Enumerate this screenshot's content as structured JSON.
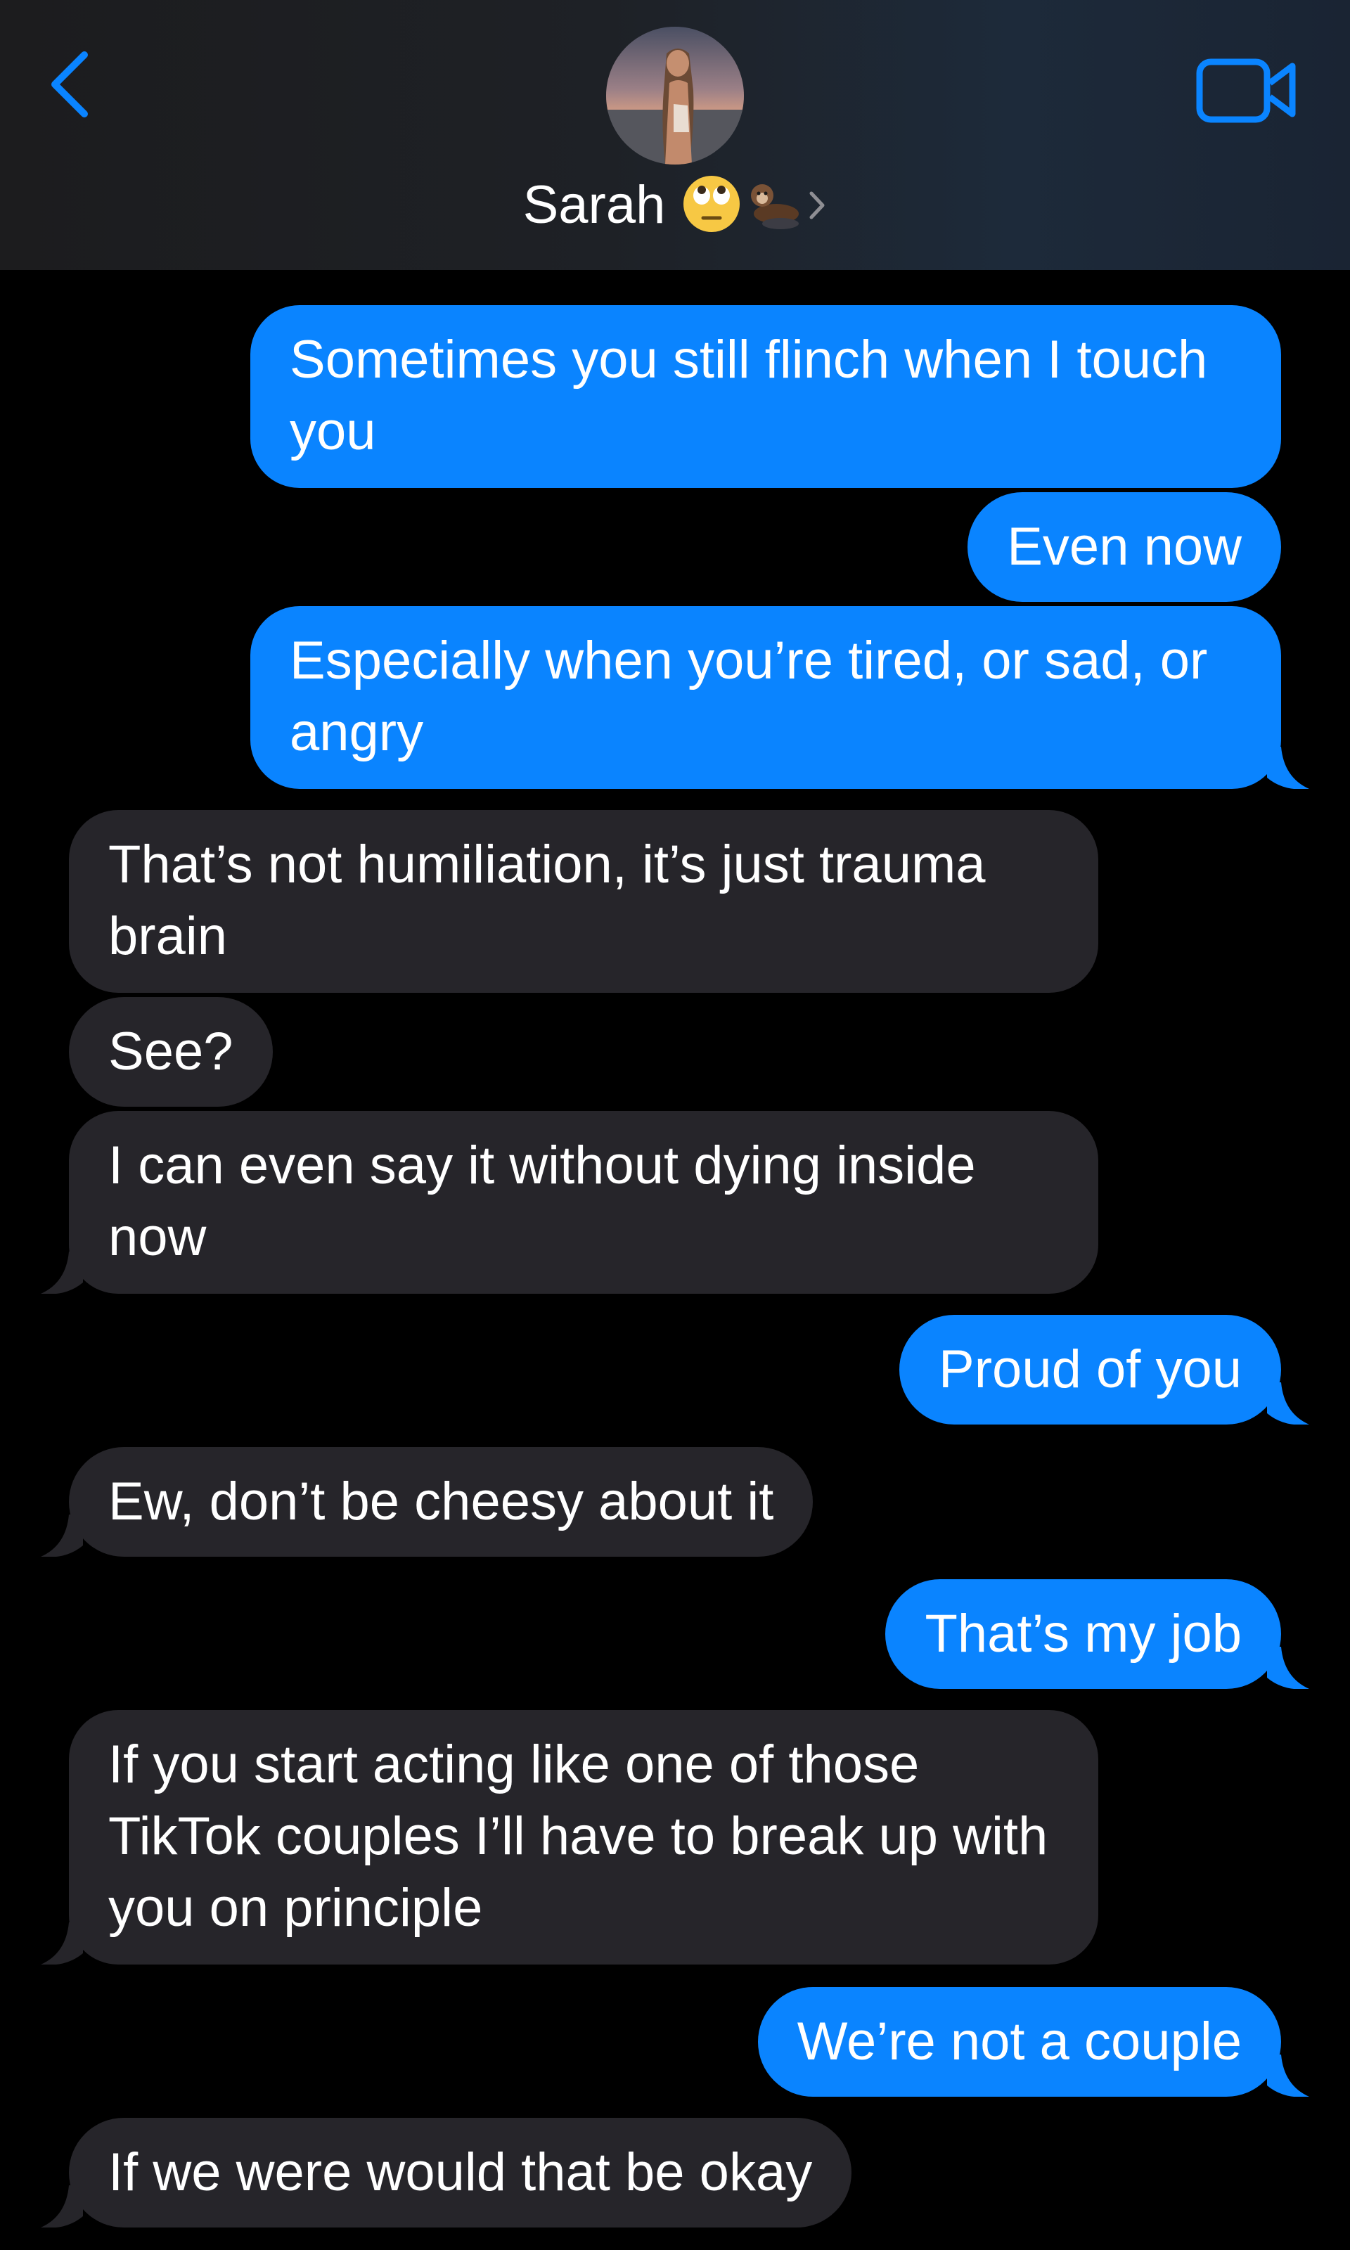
{
  "header": {
    "contact_name": "Sarah",
    "contact_emojis": [
      "🙄",
      "🦦"
    ],
    "back_icon": "chevron-left",
    "video_icon": "video-camera",
    "accent_color": "#0a84ff"
  },
  "messages": [
    {
      "from": "me",
      "text": "Sometimes you still flinch when I touch you"
    },
    {
      "from": "me",
      "text": "Even now"
    },
    {
      "from": "me",
      "text": "Especially when you’re tired, or sad, or angry"
    },
    {
      "from": "them",
      "text": "That’s not humiliation, it’s just trauma brain"
    },
    {
      "from": "them",
      "text": "See?"
    },
    {
      "from": "them",
      "text": "I can even say it without dying inside now"
    },
    {
      "from": "me",
      "text": "Proud of you"
    },
    {
      "from": "them",
      "text": "Ew, don’t be cheesy about it"
    },
    {
      "from": "me",
      "text": "That’s my job"
    },
    {
      "from": "them",
      "text": "If you start acting like one of those TikTok couples I’ll have to break up with you on principle"
    },
    {
      "from": "me",
      "text": "We’re not a couple"
    },
    {
      "from": "them",
      "text": "If we were would that be okay"
    }
  ]
}
